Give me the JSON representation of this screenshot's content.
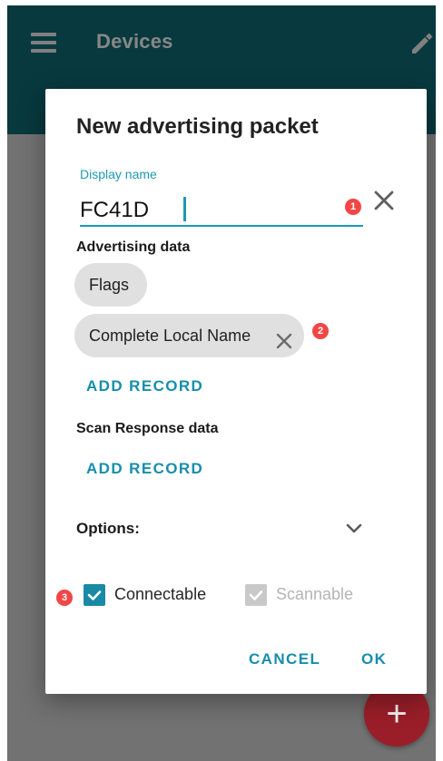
{
  "app_bar": {
    "title": "Devices",
    "menu_icon": "hamburger-menu-icon",
    "edit_icon": "pencil-icon",
    "background": "#0f6c75"
  },
  "dialog": {
    "title": "New advertising packet",
    "display_name": {
      "label": "Display name",
      "value": "FC41D",
      "clear_icon": "close-icon"
    },
    "advertising_data": {
      "title": "Advertising data",
      "records": [
        {
          "label": "Flags"
        },
        {
          "label": "Complete Local Name",
          "remove_icon": "close-icon"
        }
      ],
      "add_label": "ADD RECORD"
    },
    "scan_response_data": {
      "title": "Scan Response data",
      "add_label": "ADD RECORD"
    },
    "options": {
      "label": "Options:",
      "chevron_icon": "chevron-down-icon",
      "connectable": {
        "label": "Connectable",
        "checked": true
      },
      "scannable": {
        "label": "Scannable",
        "checked": true,
        "disabled": true
      }
    },
    "actions": {
      "cancel_label": "CANCEL",
      "ok_label": "OK"
    }
  },
  "badges": {
    "one": "1",
    "two": "2",
    "three": "3"
  },
  "fab": {
    "icon": "add-icon",
    "glyph": "+",
    "color": "#9a1e29"
  },
  "colors": {
    "accent": "#1e9ab3",
    "badge": "#f24646"
  }
}
